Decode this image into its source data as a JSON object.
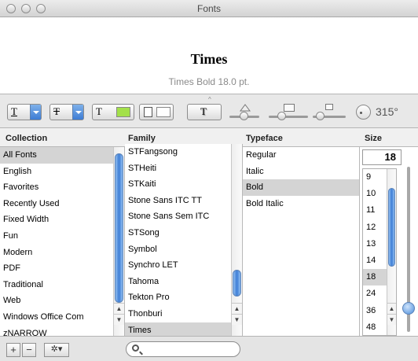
{
  "window": {
    "title": "Fonts"
  },
  "preview": {
    "font_name": "Times",
    "description": "Times Bold 18.0 pt."
  },
  "toolbar": {
    "underline_glyph": "T",
    "strikethrough_glyph": "T",
    "text_color_glyph": "T",
    "shadow_glyph": "T",
    "text_color": "#a3e04a",
    "document_color": "#ffffff",
    "rotation_value": "315°"
  },
  "columns": {
    "collection": "Collection",
    "family": "Family",
    "typeface": "Typeface",
    "size": "Size"
  },
  "collections": [
    "All Fonts",
    "English",
    "Favorites",
    "Recently Used",
    "Fixed Width",
    "Fun",
    "Modern",
    "PDF",
    "Traditional",
    "Web",
    "Windows Office Com",
    "zNARROW"
  ],
  "families": [
    "STFangsong",
    "STHeiti",
    "STKaiti",
    "Stone Sans ITC TT",
    "Stone Sans Sem ITC",
    "STSong",
    "Symbol",
    "Synchro LET",
    "Tahoma",
    "Tekton Pro",
    "Thonburi",
    "Times"
  ],
  "typefaces": [
    "Regular",
    "Italic",
    "Bold",
    "Bold Italic"
  ],
  "size": {
    "current": "18",
    "options": [
      "9",
      "10",
      "11",
      "12",
      "13",
      "14",
      "18",
      "24",
      "36",
      "48"
    ]
  },
  "footer": {
    "add_label": "+",
    "remove_label": "−",
    "action_label": "✲▾",
    "search_placeholder": ""
  },
  "selection": {
    "collection": "All Fonts",
    "family": "Times",
    "typeface": "Bold",
    "size": "18"
  },
  "colors": {
    "accent": "#3d7cd4",
    "selection_bg": "#d4d4d4"
  }
}
